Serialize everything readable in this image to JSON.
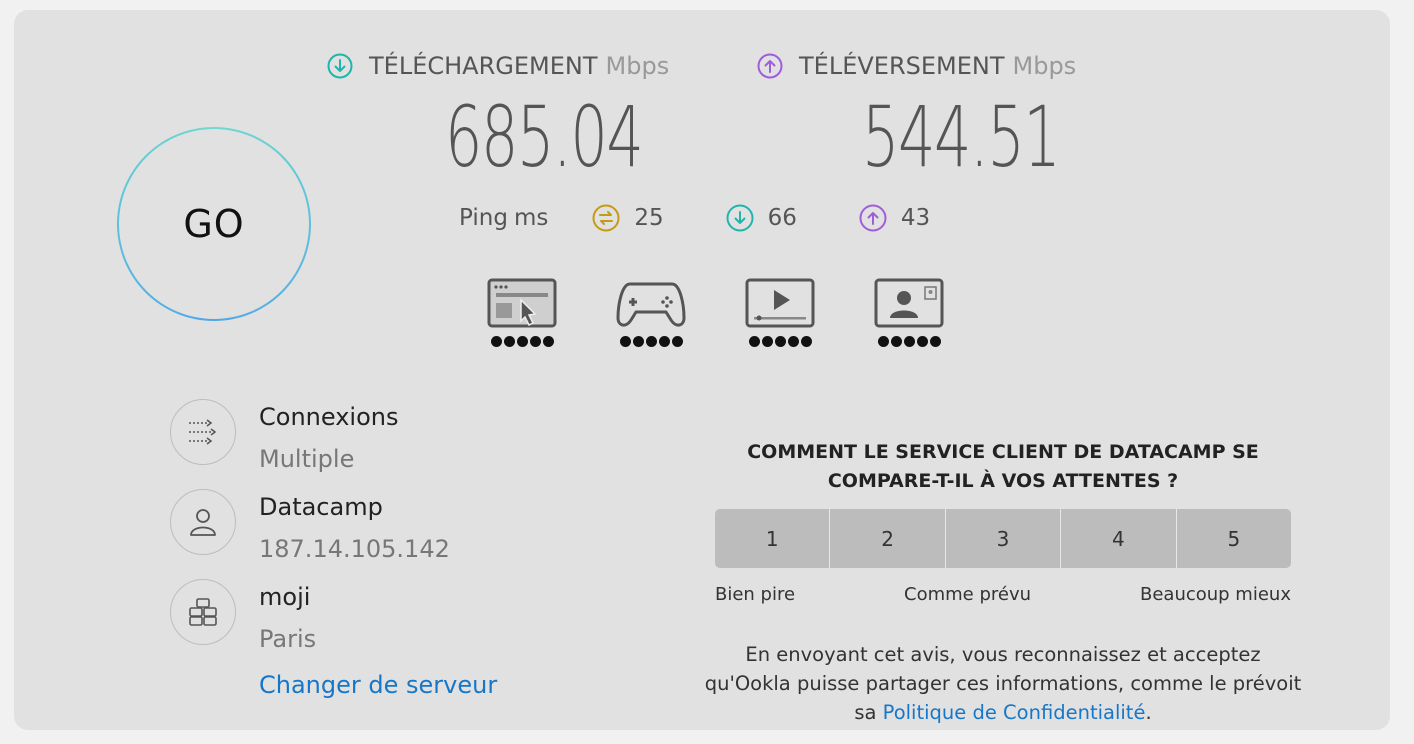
{
  "go_button": {
    "label": "GO"
  },
  "download": {
    "label": "TÉLÉCHARGEMENT",
    "unit": "Mbps",
    "value": "685.04",
    "color": "#1fb5ad"
  },
  "upload": {
    "label": "TÉLÉVERSEMENT",
    "unit": "Mbps",
    "value": "544.51",
    "color": "#a05ddb"
  },
  "ping": {
    "label": "Ping",
    "unit": "ms",
    "idle": {
      "value": "25",
      "icon": "ping-idle-icon",
      "color": "#c49b12"
    },
    "download": {
      "value": "66",
      "icon": "ping-download-icon",
      "color": "#1fb5ad"
    },
    "upload": {
      "value": "43",
      "icon": "ping-upload-icon",
      "color": "#a05ddb"
    }
  },
  "activities": [
    {
      "icon": "web-browsing-icon",
      "rating": 5
    },
    {
      "icon": "gaming-icon",
      "rating": 5
    },
    {
      "icon": "video-streaming-icon",
      "rating": 5
    },
    {
      "icon": "video-chat-icon",
      "rating": 5
    }
  ],
  "connections": {
    "title": "Connexions",
    "value": "Multiple"
  },
  "provider": {
    "title": "Datacamp",
    "value": "187.14.105.142"
  },
  "server": {
    "title": "moji",
    "value": "Paris",
    "change_link": "Changer de serveur"
  },
  "survey": {
    "question": "COMMENT LE SERVICE CLIENT DE DATACAMP SE COMPARE-T-IL À VOS ATTENTES ?",
    "options": [
      "1",
      "2",
      "3",
      "4",
      "5"
    ],
    "low_label": "Bien pire",
    "mid_label": "Comme prévu",
    "high_label": "Beaucoup mieux",
    "disclaimer_before": "En envoyant cet avis, vous reconnaissez et acceptez qu'Ookla puisse partager ces informations, comme le prévoit sa ",
    "disclaimer_link": "Politique de Confidentialité",
    "disclaimer_after": "."
  }
}
